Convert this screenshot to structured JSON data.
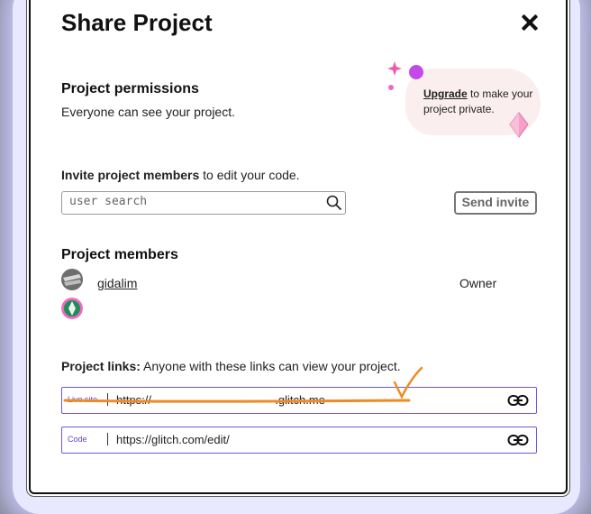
{
  "dialog": {
    "title": "Share Project",
    "close_icon": "close-icon"
  },
  "permissions": {
    "heading": "Project permissions",
    "description": "Everyone can see your project.",
    "upgrade_link": "Upgrade",
    "upgrade_text": " to make your project private."
  },
  "invite": {
    "heading_bold": "Invite project members",
    "heading_rest": " to edit your code.",
    "search_placeholder": "user search",
    "send_button": "Send invite"
  },
  "members": {
    "heading": "Project members",
    "list": [
      {
        "name": "gidalim",
        "role": "Owner"
      },
      {
        "name": "",
        "role": ""
      }
    ]
  },
  "links": {
    "heading_bold": "Project links:",
    "heading_rest": " Anyone with these links can view your project.",
    "items": [
      {
        "label": "Live site",
        "url": "https://                                      .glitch.me"
      },
      {
        "label": "Code",
        "url": "https://glitch.com/edit/"
      }
    ]
  },
  "colors": {
    "accent": "#6a57e8",
    "annotation": "#f08a24",
    "upgrade_bg": "#fbeeee"
  }
}
